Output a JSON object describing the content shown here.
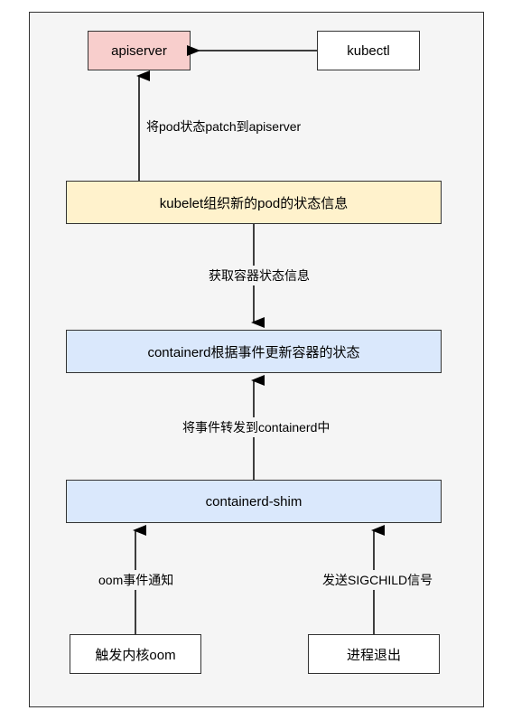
{
  "chart_data": {
    "type": "diagram",
    "title": "",
    "nodes": [
      {
        "id": "apiserver",
        "label": "apiserver",
        "color": "#f8cecc"
      },
      {
        "id": "kubectl",
        "label": "kubectl",
        "color": "#ffffff"
      },
      {
        "id": "kubelet",
        "label": "kubelet组织新的pod的状态信息",
        "color": "#fff2cc"
      },
      {
        "id": "containerd",
        "label": "containerd根据事件更新容器的状态",
        "color": "#dae8fc"
      },
      {
        "id": "containerd-shim",
        "label": "containerd-shim",
        "color": "#dae8fc"
      },
      {
        "id": "oom-trigger",
        "label": "触发内核oom",
        "color": "#ffffff"
      },
      {
        "id": "process-exit",
        "label": "进程退出",
        "color": "#ffffff"
      }
    ],
    "edges": [
      {
        "from": "kubectl",
        "to": "apiserver",
        "label": ""
      },
      {
        "from": "kubelet",
        "to": "apiserver",
        "label": "将pod状态patch到apiserver"
      },
      {
        "from": "containerd",
        "to": "kubelet",
        "label": "获取容器状态信息",
        "direction": "down"
      },
      {
        "from": "containerd-shim",
        "to": "containerd",
        "label": "将事件转发到containerd中"
      },
      {
        "from": "oom-trigger",
        "to": "containerd-shim",
        "label": "oom事件通知"
      },
      {
        "from": "process-exit",
        "to": "containerd-shim",
        "label": "发送SIGCHILD信号"
      }
    ]
  },
  "boxes": {
    "apiserver": "apiserver",
    "kubectl": "kubectl",
    "kubelet": "kubelet组织新的pod的状态信息",
    "containerd": "containerd根据事件更新容器的状态",
    "containerd_shim": "containerd-shim",
    "oom_trigger": "触发内核oom",
    "process_exit": "进程退出"
  },
  "labels": {
    "patch_pod": "将pod状态patch到apiserver",
    "get_container": "获取容器状态信息",
    "forward_event": "将事件转发到containerd中",
    "oom_notify": "oom事件通知",
    "sigchild": "发送SIGCHILD信号"
  }
}
